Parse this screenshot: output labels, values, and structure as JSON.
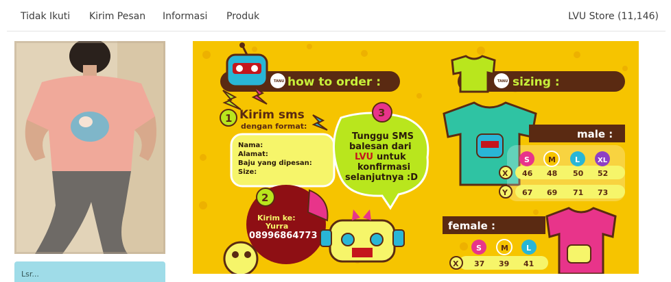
{
  "nav": {
    "items": [
      "Tidak Ikuti",
      "Kirim Pesan",
      "Informasi",
      "Produk"
    ],
    "store_label": "LVU Store (11,146)"
  },
  "sidebar": {
    "info_text": "Lsr..."
  },
  "poster": {
    "how_to_order": "how to order :",
    "sizing": "sizing :",
    "tanu_badge": "TANU",
    "step1_number": "1",
    "step1_title": "Kirim sms",
    "step1_subtitle": "dengan format:",
    "form_fields": [
      "Nama:",
      "Alamat:",
      "Baju yang dipesan:",
      "Size:"
    ],
    "step2_number": "2",
    "step2_label": "Kirim ke:",
    "step2_name": "Yurra",
    "step2_phone": "08996864773",
    "step3_number": "3",
    "step3_lines": [
      "Tunggu SMS",
      "balesan dari",
      "untuk",
      "konfirmasi",
      "selanjutnya :D"
    ],
    "step3_brand": "LVU",
    "male_label": "male :",
    "female_label": "female :",
    "male_sizes": [
      "S",
      "M",
      "L",
      "XL"
    ],
    "male_x": [
      "46",
      "48",
      "50",
      "52"
    ],
    "male_y": [
      "67",
      "69",
      "71",
      "73"
    ],
    "female_sizes": [
      "S",
      "M",
      "L"
    ],
    "female_x": [
      "37",
      "39",
      "41"
    ],
    "row_x": "X",
    "row_y": "Y"
  },
  "colors": {
    "poster_bg": "#f6c400",
    "dark_brown": "#5a2a12",
    "lime": "#b9e61d",
    "pink": "#e8348a",
    "teal": "#2fc3a3",
    "red": "#c4161c"
  }
}
